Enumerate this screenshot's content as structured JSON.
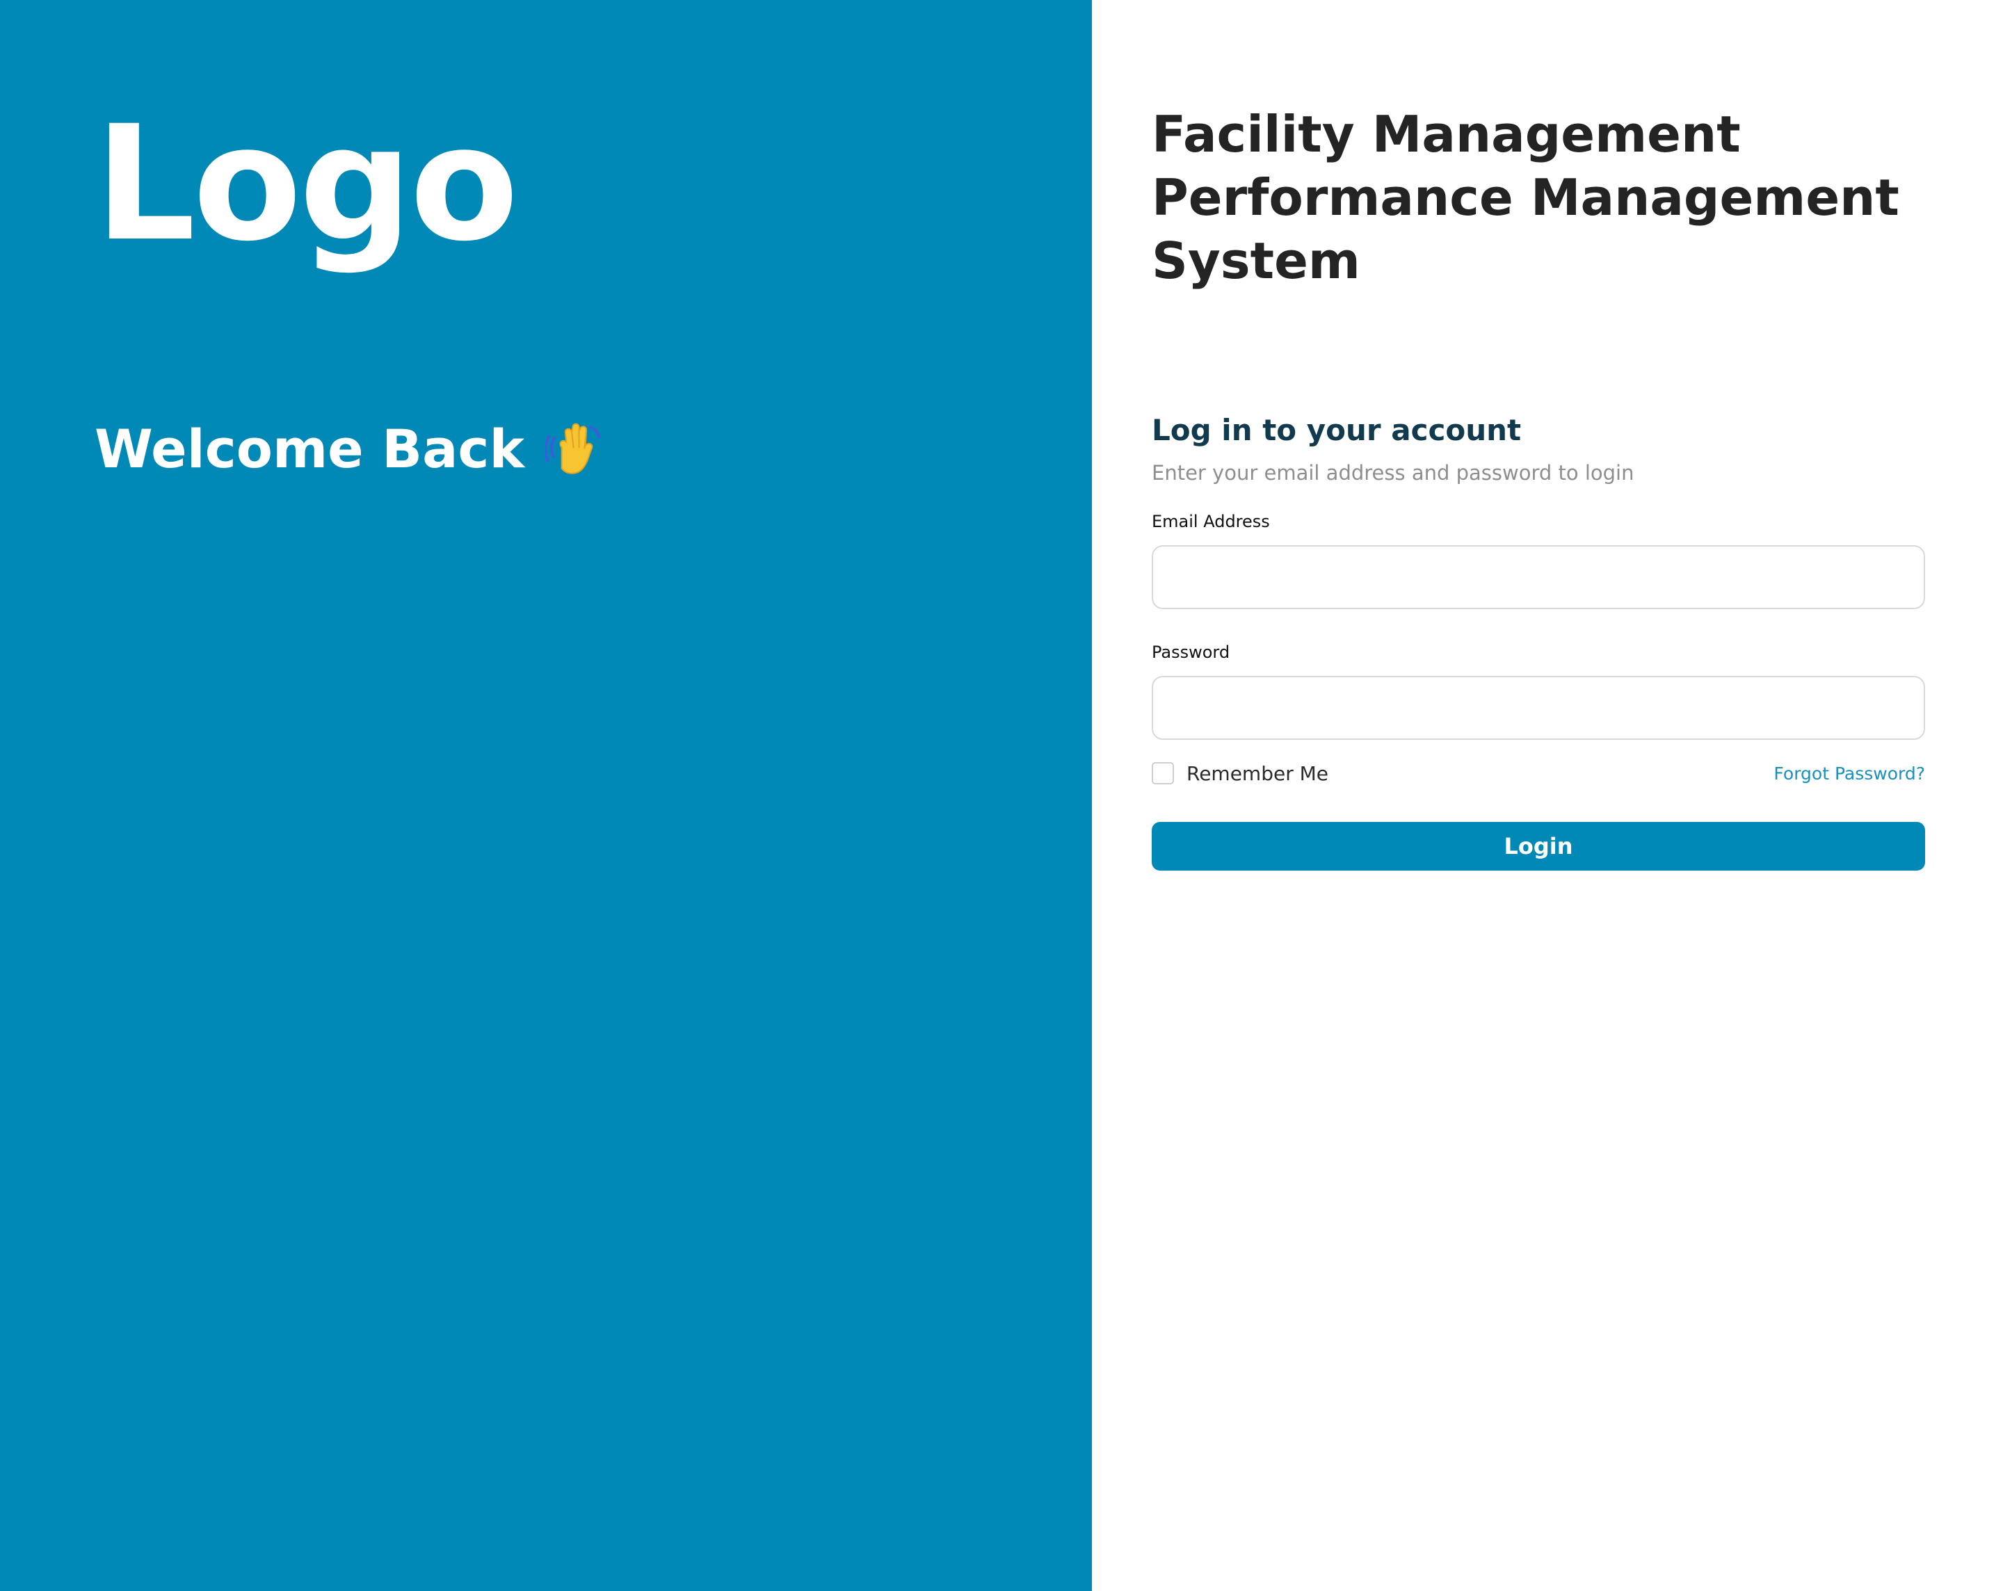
{
  "brand": {
    "logo_text": "Logo",
    "welcome_text": "Welcome Back",
    "welcome_icon": "waving-hand-icon",
    "panel_color": "#0088b6"
  },
  "app": {
    "title_line1": "Facility Management",
    "title_line2": "Performance Management",
    "title_line3": "System"
  },
  "login_form": {
    "heading": "Log in to your account",
    "subheading": "Enter your email address and password to login",
    "email_label": "Email Address",
    "email_value": "",
    "password_label": "Password",
    "password_value": "",
    "remember_label": "Remember Me",
    "remember_checked": false,
    "forgot_label": "Forgot Password?",
    "submit_label": "Login",
    "accent_color": "#0088b6",
    "link_color": "#1a8fc0"
  }
}
